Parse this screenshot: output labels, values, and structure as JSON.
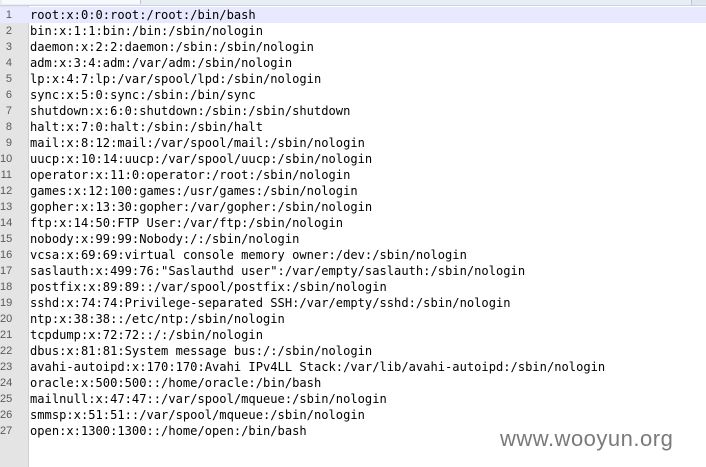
{
  "editor": {
    "lines": [
      {
        "number": "1",
        "text": "root:x:0:0:root:/root:/bin/bash"
      },
      {
        "number": "2",
        "text": "bin:x:1:1:bin:/bin:/sbin/nologin"
      },
      {
        "number": "3",
        "text": "daemon:x:2:2:daemon:/sbin:/sbin/nologin"
      },
      {
        "number": "4",
        "text": "adm:x:3:4:adm:/var/adm:/sbin/nologin"
      },
      {
        "number": "5",
        "text": "lp:x:4:7:lp:/var/spool/lpd:/sbin/nologin"
      },
      {
        "number": "6",
        "text": "sync:x:5:0:sync:/sbin:/bin/sync"
      },
      {
        "number": "7",
        "text": "shutdown:x:6:0:shutdown:/sbin:/sbin/shutdown"
      },
      {
        "number": "8",
        "text": "halt:x:7:0:halt:/sbin:/sbin/halt"
      },
      {
        "number": "9",
        "text": "mail:x:8:12:mail:/var/spool/mail:/sbin/nologin"
      },
      {
        "number": "10",
        "text": "uucp:x:10:14:uucp:/var/spool/uucp:/sbin/nologin"
      },
      {
        "number": "11",
        "text": "operator:x:11:0:operator:/root:/sbin/nologin"
      },
      {
        "number": "12",
        "text": "games:x:12:100:games:/usr/games:/sbin/nologin"
      },
      {
        "number": "13",
        "text": "gopher:x:13:30:gopher:/var/gopher:/sbin/nologin"
      },
      {
        "number": "14",
        "text": "ftp:x:14:50:FTP User:/var/ftp:/sbin/nologin"
      },
      {
        "number": "15",
        "text": "nobody:x:99:99:Nobody:/:/sbin/nologin"
      },
      {
        "number": "16",
        "text": "vcsa:x:69:69:virtual console memory owner:/dev:/sbin/nologin"
      },
      {
        "number": "17",
        "text": "saslauth:x:499:76:\"Saslauthd user\":/var/empty/saslauth:/sbin/nologin"
      },
      {
        "number": "18",
        "text": "postfix:x:89:89::/var/spool/postfix:/sbin/nologin"
      },
      {
        "number": "19",
        "text": "sshd:x:74:74:Privilege-separated SSH:/var/empty/sshd:/sbin/nologin"
      },
      {
        "number": "20",
        "text": "ntp:x:38:38::/etc/ntp:/sbin/nologin"
      },
      {
        "number": "21",
        "text": "tcpdump:x:72:72::/:/sbin/nologin"
      },
      {
        "number": "22",
        "text": "dbus:x:81:81:System message bus:/:/sbin/nologin"
      },
      {
        "number": "23",
        "text": "avahi-autoipd:x:170:170:Avahi IPv4LL Stack:/var/lib/avahi-autoipd:/sbin/nologin"
      },
      {
        "number": "24",
        "text": "oracle:x:500:500::/home/oracle:/bin/bash"
      },
      {
        "number": "25",
        "text": "mailnull:x:47:47::/var/spool/mqueue:/sbin/nologin"
      },
      {
        "number": "26",
        "text": "smmsp:x:51:51::/var/spool/mqueue:/sbin/nologin"
      },
      {
        "number": "27",
        "text": "open:x:1300:1300::/home/open:/bin/bash"
      }
    ]
  },
  "watermark": {
    "text": "www.wooyun.org"
  },
  "colors": {
    "current_line_highlight": "#e8e8ff",
    "gutter_background": "#e4e4e4",
    "text": "#000000",
    "watermark": "#7a7a7a"
  }
}
